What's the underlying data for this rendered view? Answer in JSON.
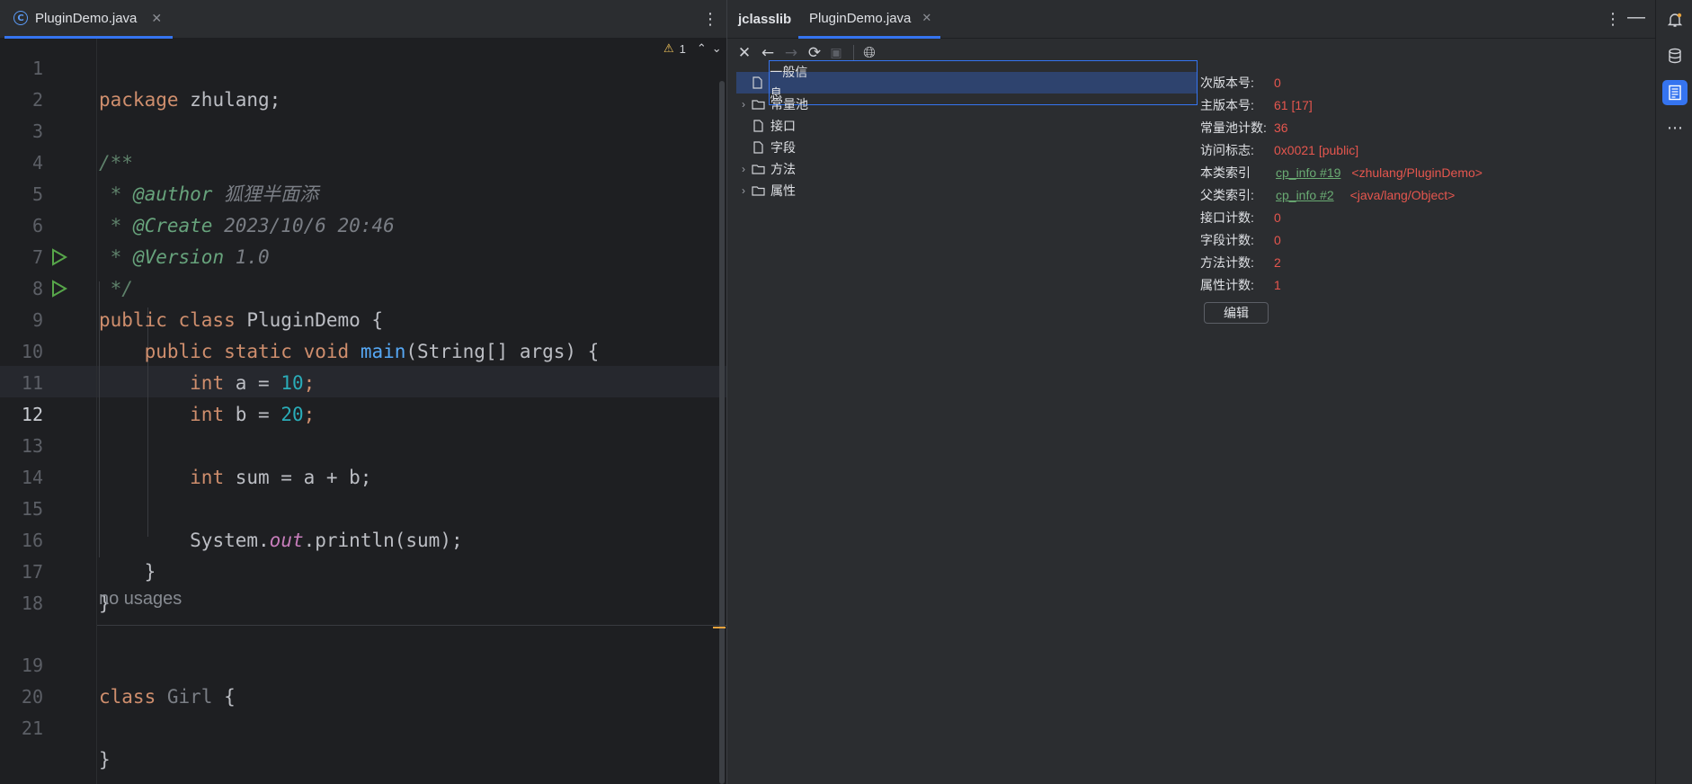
{
  "editor": {
    "tab_label": "PluginDemo.java",
    "tab_icon": "java-class-icon",
    "warning_count": "1",
    "no_usages_hint": "no usages",
    "current_line": "12",
    "lines": [
      {
        "n": "1",
        "y": 0
      },
      {
        "n": "2"
      },
      {
        "n": "3"
      },
      {
        "n": "4"
      },
      {
        "n": "5"
      },
      {
        "n": "6"
      },
      {
        "n": "7"
      },
      {
        "n": "8"
      },
      {
        "n": "9"
      },
      {
        "n": "10"
      },
      {
        "n": "11"
      },
      {
        "n": "12"
      },
      {
        "n": "13"
      },
      {
        "n": "14"
      },
      {
        "n": "15"
      },
      {
        "n": "16"
      },
      {
        "n": "17"
      },
      {
        "n": "18"
      },
      {
        "n": "19"
      },
      {
        "n": "20"
      },
      {
        "n": "21"
      }
    ],
    "code": {
      "l1_kw": "package",
      "l1_rest": " zhulang;",
      "l3": "/**",
      "l4_tag": "@author",
      "l4_val": " 狐狸半面添",
      "l5_tag": "@Create",
      "l5_val": " 2023/10/6 20:46",
      "l6_tag": "@Version",
      "l6_val": " 1.0",
      "l7": " */",
      "l8_kw": "public class",
      "l8_rest": " PluginDemo {",
      "l9_kw": "public static void",
      "l9_fn": "main",
      "l9_rest": "(String[] args) {",
      "l10_kw": "int",
      "l10_mid": " a = ",
      "l10_num": "10",
      "l10_end": ";",
      "l11_kw": "int",
      "l11_mid": " b = ",
      "l11_num": "20",
      "l11_end": ";",
      "l13_kw": "int",
      "l13_rest": " sum = a + b;",
      "l15_a": "System.",
      "l15_fld": "out",
      "l15_b": ".println(sum);",
      "l16": "}",
      "l17": "}",
      "l19_kw": "class",
      "l19_name": " Girl",
      "l19_rest": " {",
      "l21": "}"
    }
  },
  "jclasslib": {
    "tabs": [
      {
        "label": "jclasslib"
      },
      {
        "label": "PluginDemo.java"
      }
    ],
    "tree": [
      {
        "label": "一般信息",
        "expandable": false,
        "icon": "file-icon",
        "selected": true
      },
      {
        "label": "常量池",
        "expandable": true,
        "icon": "folder-icon"
      },
      {
        "label": "接口",
        "expandable": false,
        "icon": "file-icon"
      },
      {
        "label": "字段",
        "expandable": false,
        "icon": "file-icon"
      },
      {
        "label": "方法",
        "expandable": true,
        "icon": "folder-icon"
      },
      {
        "label": "属性",
        "expandable": true,
        "icon": "folder-icon"
      }
    ],
    "info": {
      "minor_version_key": "次版本号:",
      "minor_version_val": "0",
      "major_version_key": "主版本号:",
      "major_version_val": "61 [17]",
      "cp_count_key": "常量池计数:",
      "cp_count_val": "36",
      "access_flags_key": "访问标志:",
      "access_flags_val": "0x0021 [public]",
      "this_class_key": "本类索引",
      "this_class_link": "cp_info #19",
      "this_class_ref": "<zhulang/PluginDemo>",
      "super_class_key": "父类索引:",
      "super_class_link": "cp_info #2",
      "super_class_ref": "<java/lang/Object>",
      "interfaces_count_key": "接口计数:",
      "interfaces_count_val": "0",
      "fields_count_key": "字段计数:",
      "fields_count_val": "0",
      "methods_count_key": "方法计数:",
      "methods_count_val": "2",
      "attributes_count_key": "属性计数:",
      "attributes_count_val": "1",
      "edit_button": "编辑"
    }
  },
  "colors": {
    "accent": "#3574f0",
    "keyword": "#cf8e6d",
    "number": "#2aacb8",
    "value_red": "#e5564e",
    "link_green": "#6aab73"
  }
}
